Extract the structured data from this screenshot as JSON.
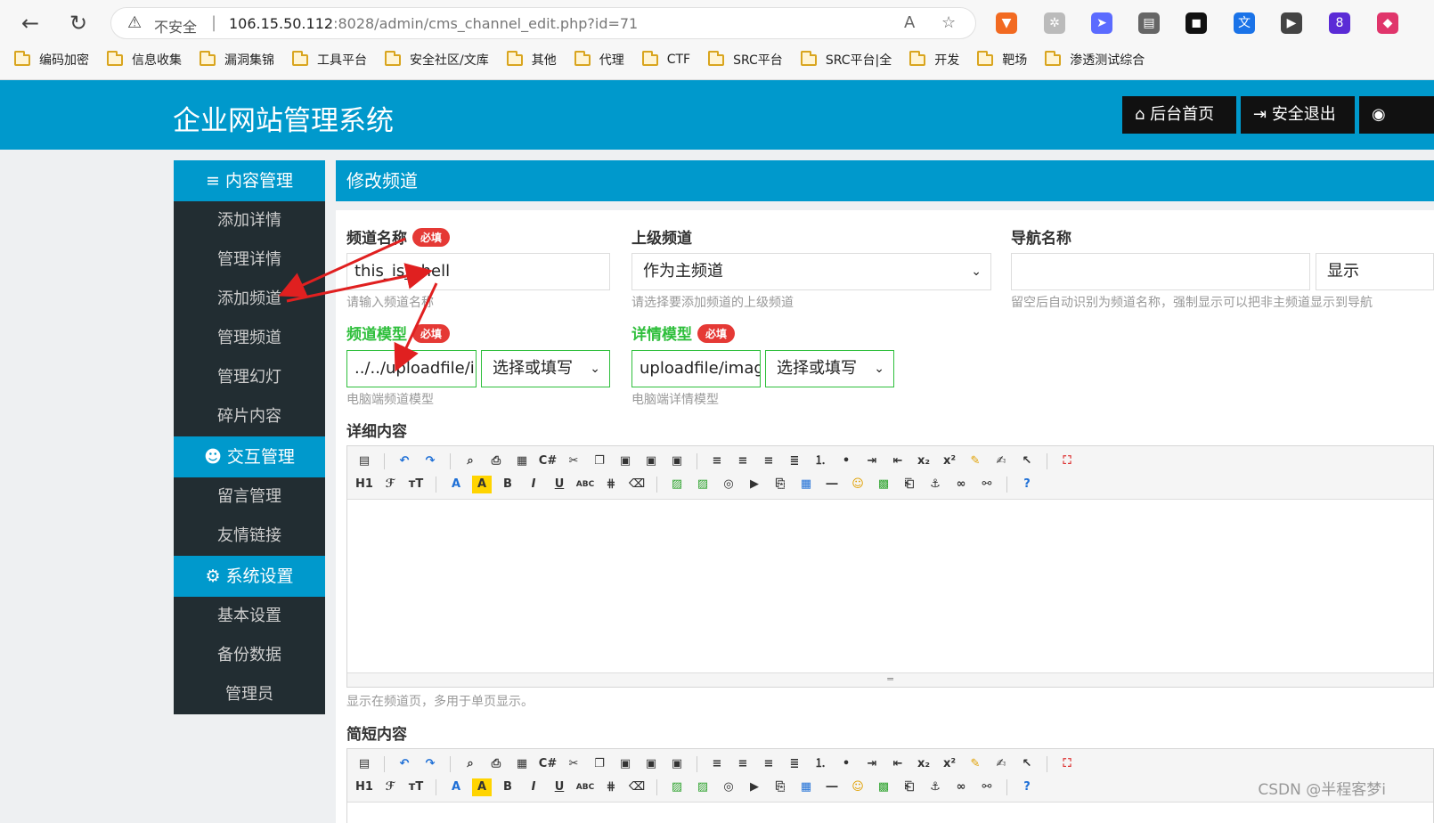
{
  "browser": {
    "insecure_label": "不安全",
    "url_host": "106.15.50.112",
    "url_path": ":8028/admin/cms_channel_edit.php?id=71",
    "extension_badge": "8",
    "bookmarks": [
      "编码加密",
      "信息收集",
      "漏洞集锦",
      "工具平台",
      "安全社区/文库",
      "其他",
      "代理",
      "CTF",
      "SRC平台",
      "SRC平台|全",
      "开发",
      "靶场",
      "渗透测试综合"
    ]
  },
  "header": {
    "title": "企业网站管理系统",
    "home_label": "后台首页",
    "logout_label": "安全退出"
  },
  "sidebar": {
    "content_mgmt": "内容管理",
    "content_items": [
      "添加详情",
      "管理详情",
      "添加频道",
      "管理频道",
      "管理幻灯",
      "碎片内容"
    ],
    "interact_mgmt": "交互管理",
    "interact_items": [
      "留言管理",
      "友情链接"
    ],
    "system_settings": "系统设置",
    "system_items": [
      "基本设置",
      "备份数据",
      "管理员"
    ]
  },
  "panel": {
    "title": "修改频道",
    "required_badge": "必填",
    "channel_name_label": "频道名称",
    "channel_name_value": "this_is_shell",
    "channel_name_hint": "请输入频道名称",
    "parent_label": "上级频道",
    "parent_value": "作为主频道",
    "parent_hint": "请选择要添加频道的上级频道",
    "nav_label": "导航名称",
    "nav_value": "",
    "nav_show": "显示",
    "nav_hint": "留空后自动识别为频道名称，强制显示可以把非主频道显示到导航",
    "channel_model_label": "频道模型",
    "channel_model_value": "../../uploadfile/in",
    "channel_model_select": "选择或填写",
    "channel_model_hint": "电脑端频道模型",
    "detail_model_label": "详情模型",
    "detail_model_value": "uploadfile/imag",
    "detail_model_select": "选择或填写",
    "detail_model_hint": "电脑端详情模型",
    "detail_content_label": "详细内容",
    "detail_content_hint": "显示在频道页，多用于单页显示。",
    "short_content_label": "简短内容"
  },
  "toolbar": {
    "heading": "H1",
    "bold": "B",
    "italic": "I",
    "underline": "U",
    "strike": "ABC"
  },
  "watermark": "CSDN @半程客梦i",
  "colors": {
    "brand_blue": "#0099cc",
    "sidebar_dark": "#222d32",
    "required_red": "#e53935",
    "model_green": "#2fbf3c"
  }
}
